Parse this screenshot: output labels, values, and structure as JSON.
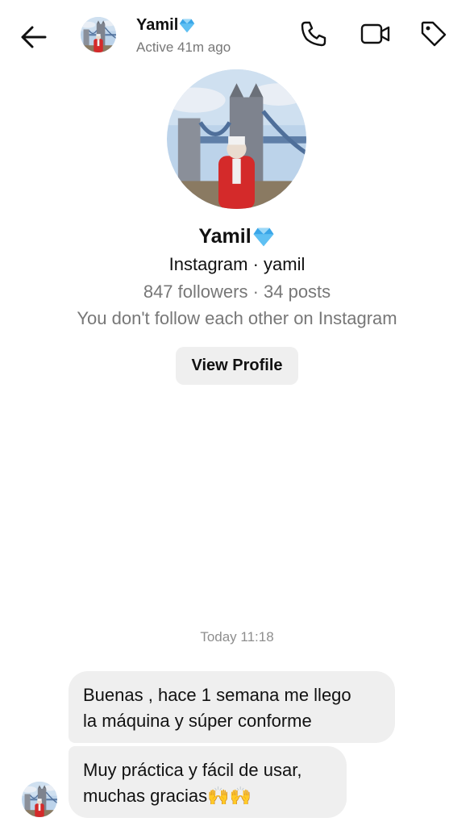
{
  "header": {
    "name": "Yamil",
    "status": "Active 41m ago",
    "icons": [
      "back-arrow-icon",
      "phone-icon",
      "video-camera-icon",
      "tag-icon"
    ]
  },
  "profile": {
    "name": "Yamil",
    "platform_line": "Instagram · yamil",
    "stats": "847 followers · 34 posts",
    "relation": "You don't follow each other on Instagram",
    "view_profile_label": "View Profile"
  },
  "chat": {
    "timestamp": "Today 11:18",
    "messages": [
      {
        "text": "Buenas , hace 1 semana me llego\nla máquina y súper conforme"
      },
      {
        "text": "Muy práctica y fácil de usar,\nmuchas gracias🙌🙌"
      }
    ]
  },
  "colors": {
    "bubble": "#efefef",
    "secondary_text": "#777777",
    "diamond": "#3aa6e8"
  }
}
